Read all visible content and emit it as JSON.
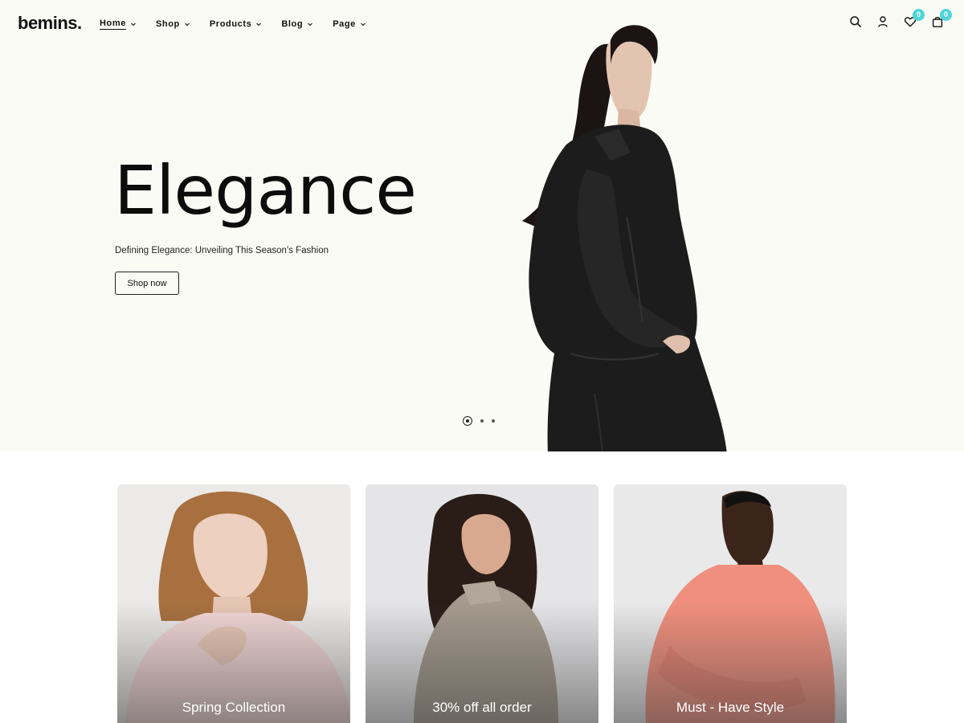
{
  "header": {
    "logo": "bemins.",
    "nav": [
      {
        "label": "Home",
        "active": true
      },
      {
        "label": "Shop"
      },
      {
        "label": "Products"
      },
      {
        "label": "Blog"
      },
      {
        "label": "Page"
      }
    ],
    "icons": [
      "search-icon",
      "user-icon",
      "heart-icon",
      "bag-icon"
    ],
    "wishlist_count": "0",
    "cart_count": "0",
    "badge_color": "#4fd6d9"
  },
  "hero": {
    "title": "Elegance",
    "subtitle": "Defining Elegance: Unveiling This Season's Fashion",
    "button_label": "Shop now",
    "slides": 3,
    "active_slide": 1,
    "background": "#fbfbf5"
  },
  "cards": [
    {
      "label": "Spring Collection"
    },
    {
      "label": "30% off all order"
    },
    {
      "label": "Must - Have Style"
    }
  ]
}
